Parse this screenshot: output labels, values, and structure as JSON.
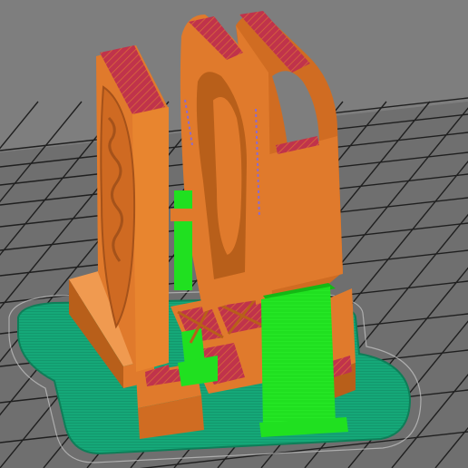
{
  "viewer": {
    "background": "#7e7e7e",
    "bed": "#6f6f6f",
    "grid_line": "#1f1f1f",
    "bed_edge": "#c9c9c9"
  },
  "colors": {
    "perimeter": "#e07a2c",
    "perimeter_shade": "#b85f1a",
    "perimeter_light": "#f09a50",
    "infill": "#c0334b",
    "infill_hatch": "#7a9a3a",
    "support": "#20e020",
    "support_shade": "#14b814",
    "skirt_brim": "#15a878",
    "skirt_brim_dark": "#0e7e58"
  },
  "icons": {
    "build_plate": "grid-bed-icon",
    "model": "sliced-model-preview"
  }
}
